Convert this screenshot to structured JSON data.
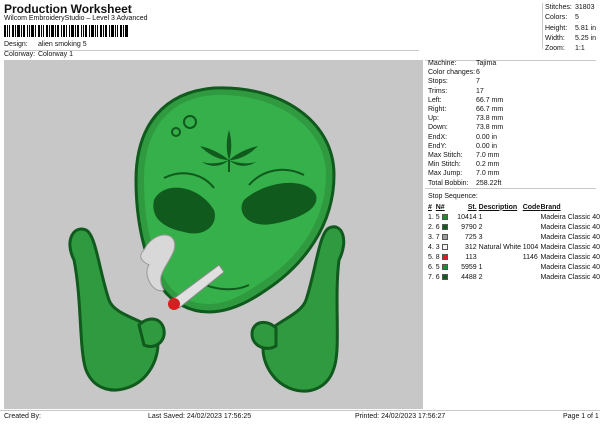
{
  "header": {
    "title": "Production Worksheet",
    "subtitle": "Wilcom EmbroideryStudio – Level 3 Advanced"
  },
  "meta": [
    {
      "key": "Design:",
      "value": "alien smoking 5"
    },
    {
      "key": "Colorway:",
      "value": "Colorway 1"
    }
  ],
  "stats": [
    {
      "key": "Stitches:",
      "value": "31803"
    },
    {
      "key": "Colors:",
      "value": "5"
    },
    {
      "key": "Height:",
      "value": "5.81 in"
    },
    {
      "key": "Width:",
      "value": "5.25 in"
    },
    {
      "key": "Zoom:",
      "value": "1:1"
    }
  ],
  "machine_info": [
    {
      "key": "Machine:",
      "value": "Tajima"
    },
    {
      "key": "Color changes:",
      "value": "6"
    },
    {
      "key": "Stops:",
      "value": "7"
    },
    {
      "key": "Trims:",
      "value": "17"
    },
    {
      "key": "Left:",
      "value": "66.7 mm"
    },
    {
      "key": "Right:",
      "value": "66.7 mm"
    },
    {
      "key": "Up:",
      "value": "73.8 mm"
    },
    {
      "key": "Down:",
      "value": "73.8 mm"
    },
    {
      "key": "EndX:",
      "value": "0.00 in"
    },
    {
      "key": "EndY:",
      "value": "0.00 in"
    },
    {
      "key": "Max Stitch:",
      "value": "7.0 mm"
    },
    {
      "key": "Min Stitch:",
      "value": "0.2 mm"
    },
    {
      "key": "Max Jump:",
      "value": "7.0 mm"
    },
    {
      "key": "Total Bobbin:",
      "value": "258.22ft"
    }
  ],
  "stop_sequence": {
    "title": "Stop Sequence:",
    "headers": {
      "num": "#",
      "n": "N#",
      "st": "St.",
      "desc": "Description",
      "code": "Code",
      "brand": "Brand"
    },
    "rows": [
      {
        "num": "1.",
        "n": "5",
        "color": "#1f8a2e",
        "st": "10414",
        "desc": "1",
        "code": "",
        "brand": "Madeira Classic 40"
      },
      {
        "num": "2.",
        "n": "6",
        "color": "#0f5a1c",
        "st": "9790",
        "desc": "2",
        "code": "",
        "brand": "Madeira Classic 40"
      },
      {
        "num": "3.",
        "n": "7",
        "color": "#9a9a9a",
        "st": "725",
        "desc": "3",
        "code": "",
        "brand": "Madeira Classic 40"
      },
      {
        "num": "4.",
        "n": "3",
        "color": "#f2f2f2",
        "st": "312",
        "desc": "Natural White",
        "code": "1004",
        "brand": "Madeira Classic 40"
      },
      {
        "num": "5.",
        "n": "8",
        "color": "#d42020",
        "st": "113",
        "desc": "",
        "code": "1146",
        "brand": "Madeira Classic 40"
      },
      {
        "num": "6.",
        "n": "5",
        "color": "#1f8a2e",
        "st": "5959",
        "desc": "1",
        "code": "",
        "brand": "Madeira Classic 40"
      },
      {
        "num": "7.",
        "n": "6",
        "color": "#0f5a1c",
        "st": "4488",
        "desc": "2",
        "code": "",
        "brand": "Madeira Classic 40"
      }
    ]
  },
  "footer": {
    "created_by": "Created By:",
    "last_saved": "Last Saved: 24/02/2023 17:56:25",
    "printed": "Printed: 24/02/2023 17:56:27",
    "page": "Page 1 of 1"
  }
}
